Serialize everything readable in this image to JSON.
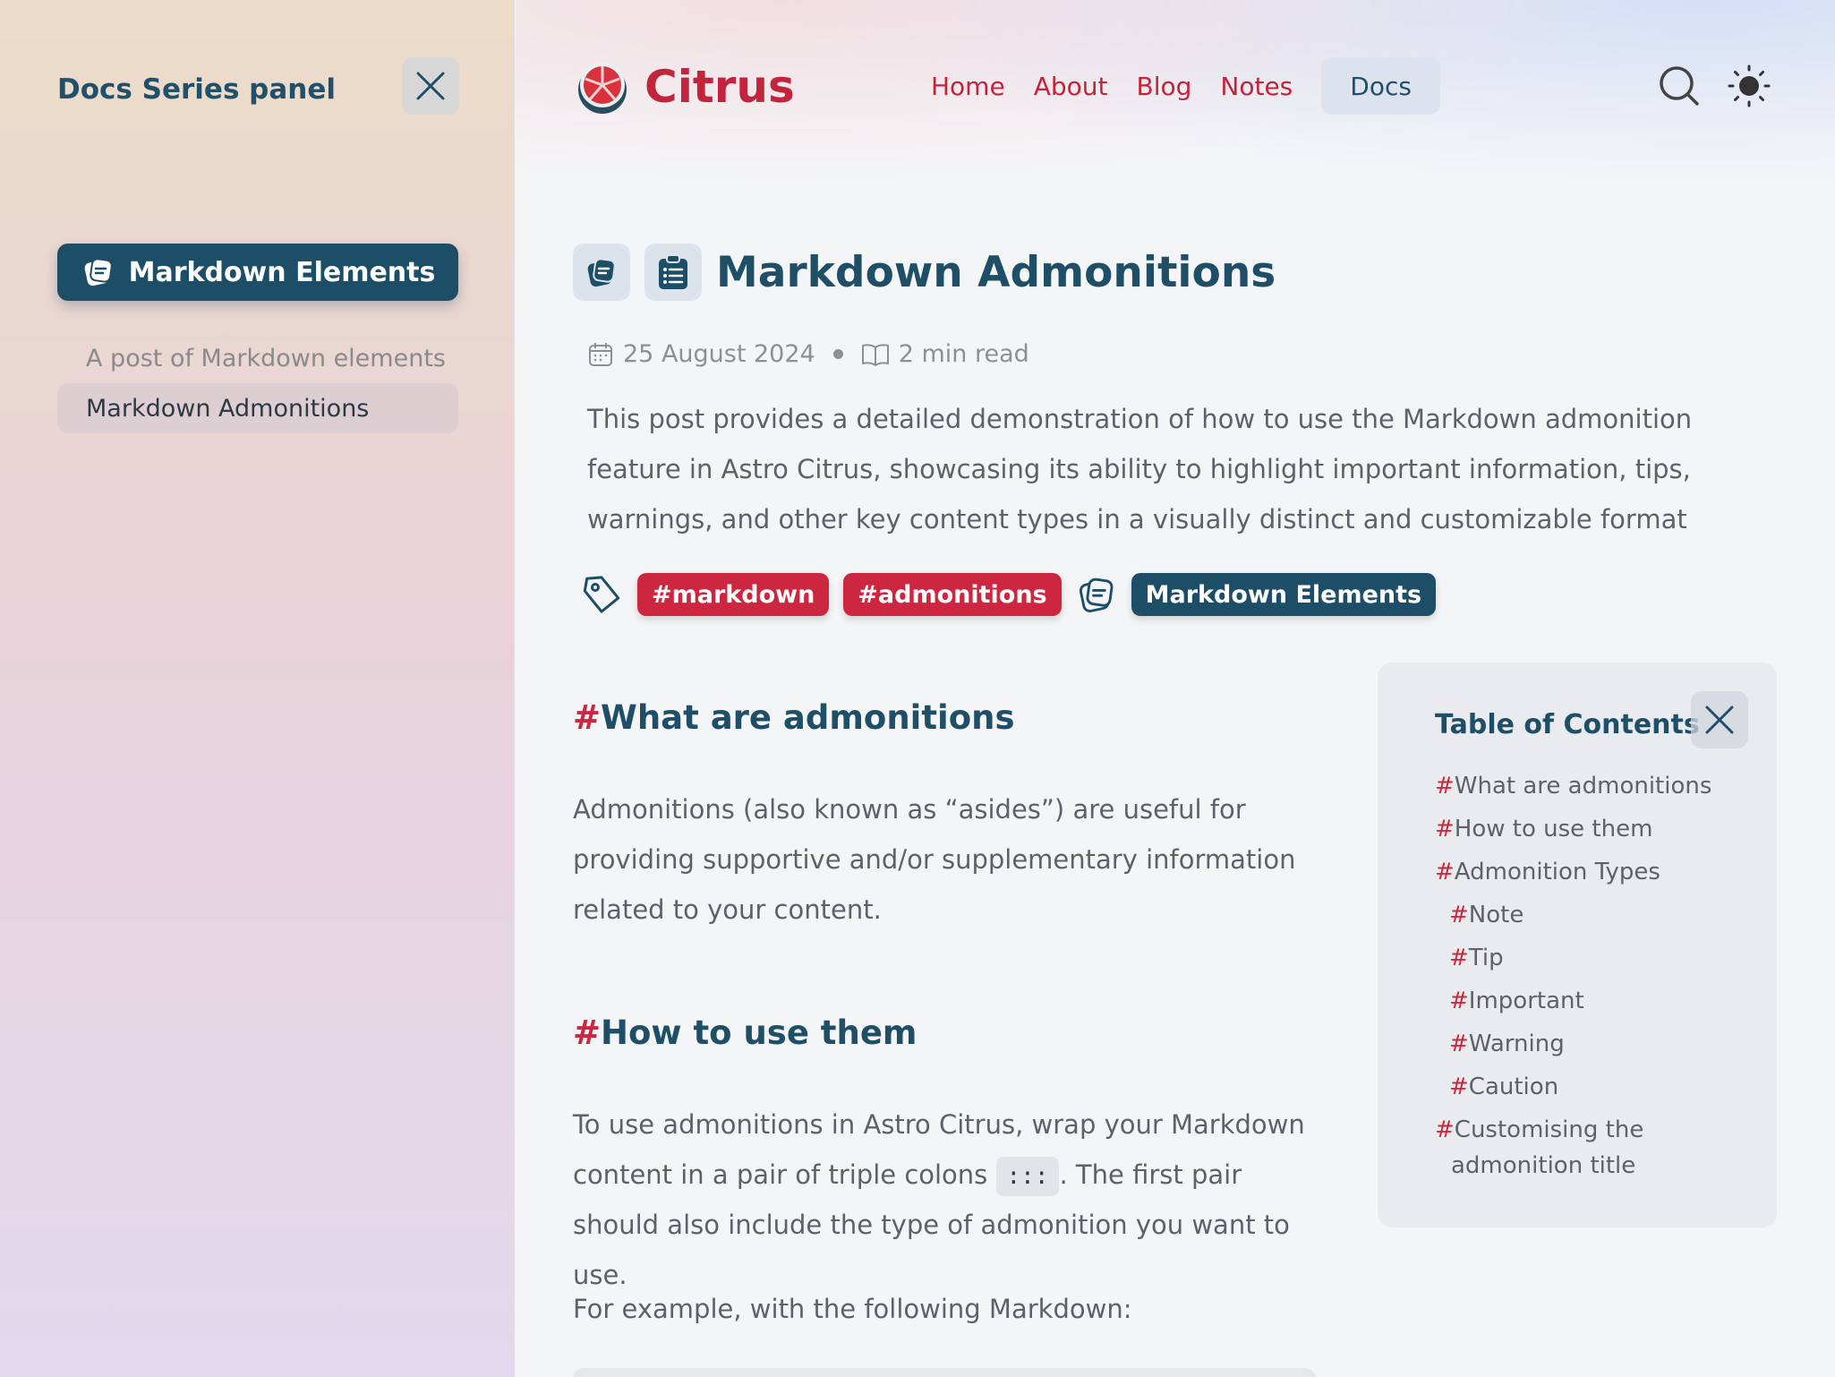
{
  "sidebar": {
    "title": "Docs Series panel",
    "series_label": "Markdown Elements",
    "items": [
      {
        "label": "A post of Markdown elements"
      },
      {
        "label": "Markdown Admonitions"
      }
    ]
  },
  "header": {
    "logo_text": "Citrus",
    "nav": [
      "Home",
      "About",
      "Blog",
      "Notes",
      "Docs"
    ],
    "active_nav": "Docs"
  },
  "article": {
    "title": "Markdown Admonitions",
    "date": "25 August 2024",
    "read_time": "2 min read",
    "description": "This post provides a detailed demonstration of how to use the Markdown admonition feature in Astro Citrus, showcasing its ability to highlight important information, tips, warnings, and other key content types in a visually distinct and customizable format",
    "tags": [
      "#markdown",
      "#admonitions"
    ],
    "series_tag": "Markdown Elements",
    "sections": [
      {
        "hash": "#",
        "heading": "What are admonitions",
        "body": "Admonitions (also known as “asides”) are useful for providing supportive and/or supplementary information related to your content."
      },
      {
        "hash": "#",
        "heading": "How to use them",
        "body_before": "To use admonitions in Astro Citrus, wrap your Markdown content in a pair of triple colons ",
        "code": ":::",
        "body_after": ". The first pair should also include the type of admonition you want to use.",
        "example": "For example, with the following Markdown:"
      }
    ]
  },
  "toc": {
    "title": "Table of Contents",
    "items": [
      {
        "hash": "#",
        "label": "What are admonitions"
      },
      {
        "hash": "#",
        "label": "How to use them"
      },
      {
        "hash": "#",
        "label": "Admonition Types"
      },
      {
        "hash": "#",
        "label": "Note"
      },
      {
        "hash": "#",
        "label": "Tip"
      },
      {
        "hash": "#",
        "label": "Important"
      },
      {
        "hash": "#",
        "label": "Warning"
      },
      {
        "hash": "#",
        "label": "Caution"
      },
      {
        "hash": "#",
        "label": "Customising the admonition title"
      }
    ]
  },
  "colors": {
    "accent_red": "#cc2640",
    "accent_blue": "#1d4e67"
  },
  "icons": [
    "close-icon",
    "series-icon",
    "watermelon-logo-icon",
    "search-icon",
    "sun-icon",
    "clipboard-icon",
    "calendar-icon",
    "book-icon",
    "tag-icon"
  ]
}
